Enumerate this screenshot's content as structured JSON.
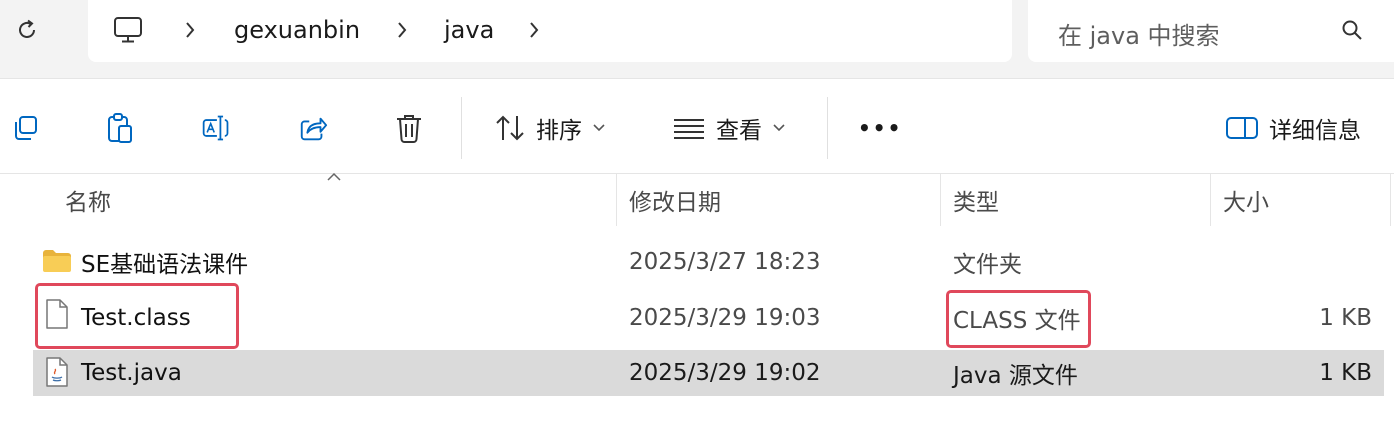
{
  "address_bar": {
    "root_icon": "computer-icon",
    "breadcrumbs": [
      "gexuanbin",
      "java"
    ]
  },
  "search": {
    "placeholder": "在 java 中搜索",
    "icon": "search-icon"
  },
  "toolbar": {
    "icons": [
      "copy-icon",
      "paste-icon",
      "rename-icon",
      "share-icon",
      "delete-icon"
    ],
    "sort_label": "排序",
    "view_label": "查看",
    "more_label": "•••",
    "details_label": "详细信息"
  },
  "columns": {
    "name": "名称",
    "date": "修改日期",
    "type": "类型",
    "size": "大小"
  },
  "files": [
    {
      "icon": "folder-icon",
      "name": "SE基础语法课件",
      "date": "2025/3/27 18:23",
      "type": "文件夹",
      "size": "",
      "selected": false,
      "highlighted": false
    },
    {
      "icon": "file-icon",
      "name": "Test.class",
      "date": "2025/3/29 19:03",
      "type": "CLASS 文件",
      "size": "1 KB",
      "selected": false,
      "highlighted": true
    },
    {
      "icon": "java-file-icon",
      "name": "Test.java",
      "date": "2025/3/29 19:02",
      "type": "Java 源文件",
      "size": "1 KB",
      "selected": true,
      "highlighted": false
    }
  ],
  "colors": {
    "highlight": "#e0485b",
    "selection": "#dadada",
    "accent": "#0067c0"
  }
}
